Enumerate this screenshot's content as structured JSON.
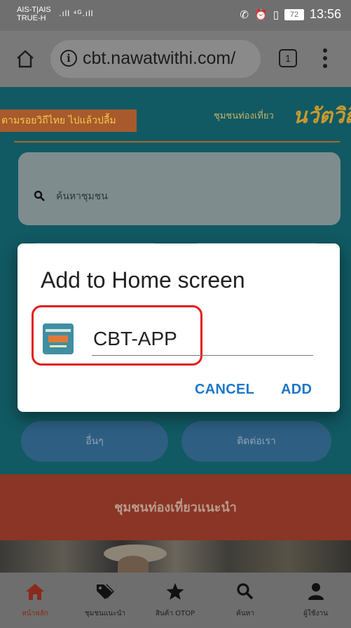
{
  "status_bar": {
    "carrier_line1": "AIS-T|AIS",
    "carrier_line2": "TRUE-H",
    "signal": ".ıll ⁴ᴳ.ıll",
    "battery": "72",
    "time": "13:56"
  },
  "browser": {
    "url": "cbt.nawatwithi.com/",
    "tab_count": "1"
  },
  "page": {
    "banner_left": "ตามรอยวิถีไทย ไปแล้วปลื้ม",
    "banner_right": "ชุมชนท่องเที่ยว",
    "banner_logo": "นวัตวิถี",
    "search_placeholder": "ค้นหาชุมชน",
    "buttons": {
      "other": "อื่นๆ",
      "contact": "ติดต่อเรา"
    },
    "section_title": "ชุมชนท่องเที่ยวแนะนำ"
  },
  "bottom_nav": [
    {
      "label": "หน้าหลัก",
      "icon": "home-icon",
      "active": true
    },
    {
      "label": "ชุมชนแนะนำ",
      "icon": "tags-icon",
      "active": false
    },
    {
      "label": "สินค้า OTOP",
      "icon": "star-icon",
      "active": false
    },
    {
      "label": "ค้นหา",
      "icon": "search-icon",
      "active": false
    },
    {
      "label": "ผู้ใช้งาน",
      "icon": "user-icon",
      "active": false
    }
  ],
  "dialog": {
    "title": "Add to Home screen",
    "app_name_value": "CBT-APP",
    "cancel_label": "CANCEL",
    "add_label": "ADD"
  },
  "colors": {
    "accent_blue": "#1e78c8",
    "highlight_red": "#e01e1e",
    "page_teal": "#115a63"
  }
}
